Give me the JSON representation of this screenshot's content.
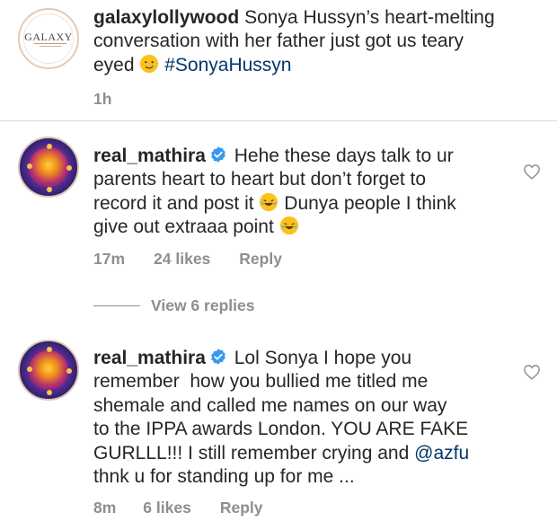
{
  "caption": {
    "username": "galaxylollywood",
    "line1_text": "Sonya Hussyn’s heart-melting",
    "line2_text": "conversation with her father just got us teary",
    "line3_text": "eyed",
    "hashtag": "#SonyaHussyn",
    "emoji": "teary-smile-emoji",
    "timestamp": "1h",
    "logo": {
      "word": "GALAXY",
      "sub": "Lollywood"
    }
  },
  "comments": [
    {
      "username": "real_mathira",
      "verified": true,
      "lines": [
        "Hehe these days talk to ur",
        "parents heart to heart but don’t forget to",
        "record it and post it",
        "Dunya people I think",
        "give out extraaa point"
      ],
      "emoji": "laughing-tears-emoji",
      "time": "17m",
      "likes": "24 likes",
      "reply_label": "Reply",
      "view_replies": "View 6 replies"
    },
    {
      "username": "real_mathira",
      "verified": true,
      "lines": [
        "Lol Sonya I hope you",
        "remember  how you bullied me titled me",
        "shemale and called me names on our way",
        "to the IPPA awards London. YOU ARE FAKE",
        "GURLLL!!! I still remember crying and",
        "@azfu",
        "thnk u for standing up for me ..."
      ],
      "time": "8m",
      "likes": "6 likes",
      "reply_label": "Reply"
    }
  ],
  "colors": {
    "text": "#262626",
    "meta": "#8e8e8e",
    "link": "#00376b",
    "verified": "#3897f0",
    "divider": "#dbdbdb"
  }
}
